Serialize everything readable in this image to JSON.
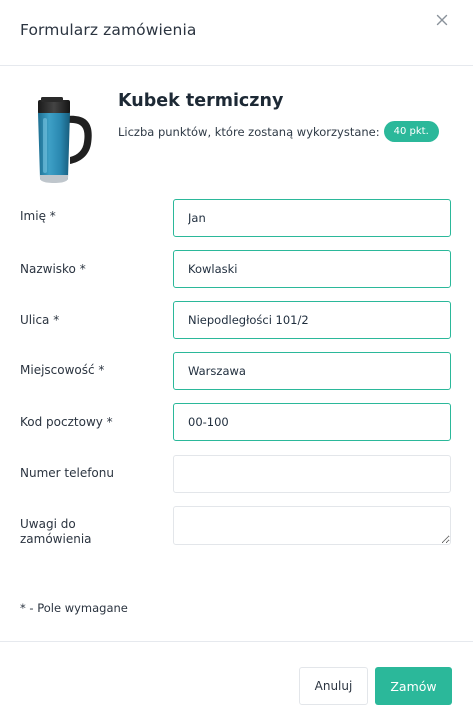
{
  "modal": {
    "title": "Formularz zamówienia",
    "close_icon": "close-icon"
  },
  "product": {
    "name": "Kubek termiczny",
    "points_text": "Liczba punktów, które zostaną wykorzystane:",
    "points_badge": "40 pkt.",
    "image_icon": "thermal-mug-image"
  },
  "form": {
    "fields": [
      {
        "label": "Imię *",
        "value": "Jan"
      },
      {
        "label": "Nazwisko *",
        "value": "Kowlaski"
      },
      {
        "label": "Ulica *",
        "value": "Niepodległości 101/2"
      },
      {
        "label": "Miejscowość *",
        "value": "Warszawa"
      },
      {
        "label": "Kod pocztowy *",
        "value": "00-100"
      },
      {
        "label": "Numer telefonu",
        "value": ""
      }
    ],
    "notes": {
      "label_line1": "Uwagi do",
      "label_line2": "zamówienia",
      "value": ""
    },
    "required_note": "* - Pole wymagane"
  },
  "footer": {
    "cancel_label": "Anuluj",
    "submit_label": "Zamów"
  },
  "colors": {
    "accent": "#2bb89a",
    "border": "#e3e6ea",
    "text": "#2b3440"
  }
}
